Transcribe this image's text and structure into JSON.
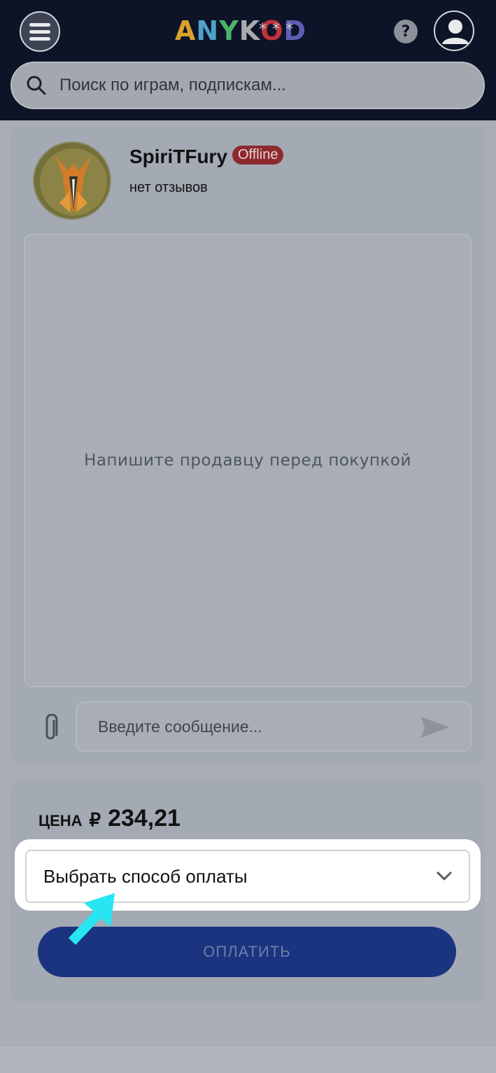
{
  "header": {
    "logo_letters": [
      {
        "char": "A",
        "color": "#d9a22b"
      },
      {
        "char": "N",
        "color": "#4ea2c9"
      },
      {
        "char": "Y",
        "color": "#4bb36a"
      },
      {
        "char": "K",
        "color": "#a8aab0"
      },
      {
        "char": "O",
        "color": "#c4323a"
      },
      {
        "char": "D",
        "color": "#5d5fb6"
      }
    ],
    "logo_stars": "***",
    "help_label": "?",
    "search_placeholder": "Поиск по играм, подпискам..."
  },
  "seller": {
    "name": "SpiriTFury",
    "status": "Offline",
    "reviews": "нет отзывов"
  },
  "chat": {
    "empty_text": "Напишите продавцу перед покупкой",
    "input_placeholder": "Введите сообщение..."
  },
  "payment": {
    "price_label": "ЦЕНА",
    "currency": "₽",
    "amount": "234,21",
    "method_placeholder": "Выбрать способ оплаты",
    "pay_label": "ОПЛАТИТЬ"
  },
  "colors": {
    "header_bg": "#0d1428",
    "pay_button": "#1a3480",
    "offline_badge": "#8e2a2e",
    "highlight_arrow": "#27e6f2"
  }
}
